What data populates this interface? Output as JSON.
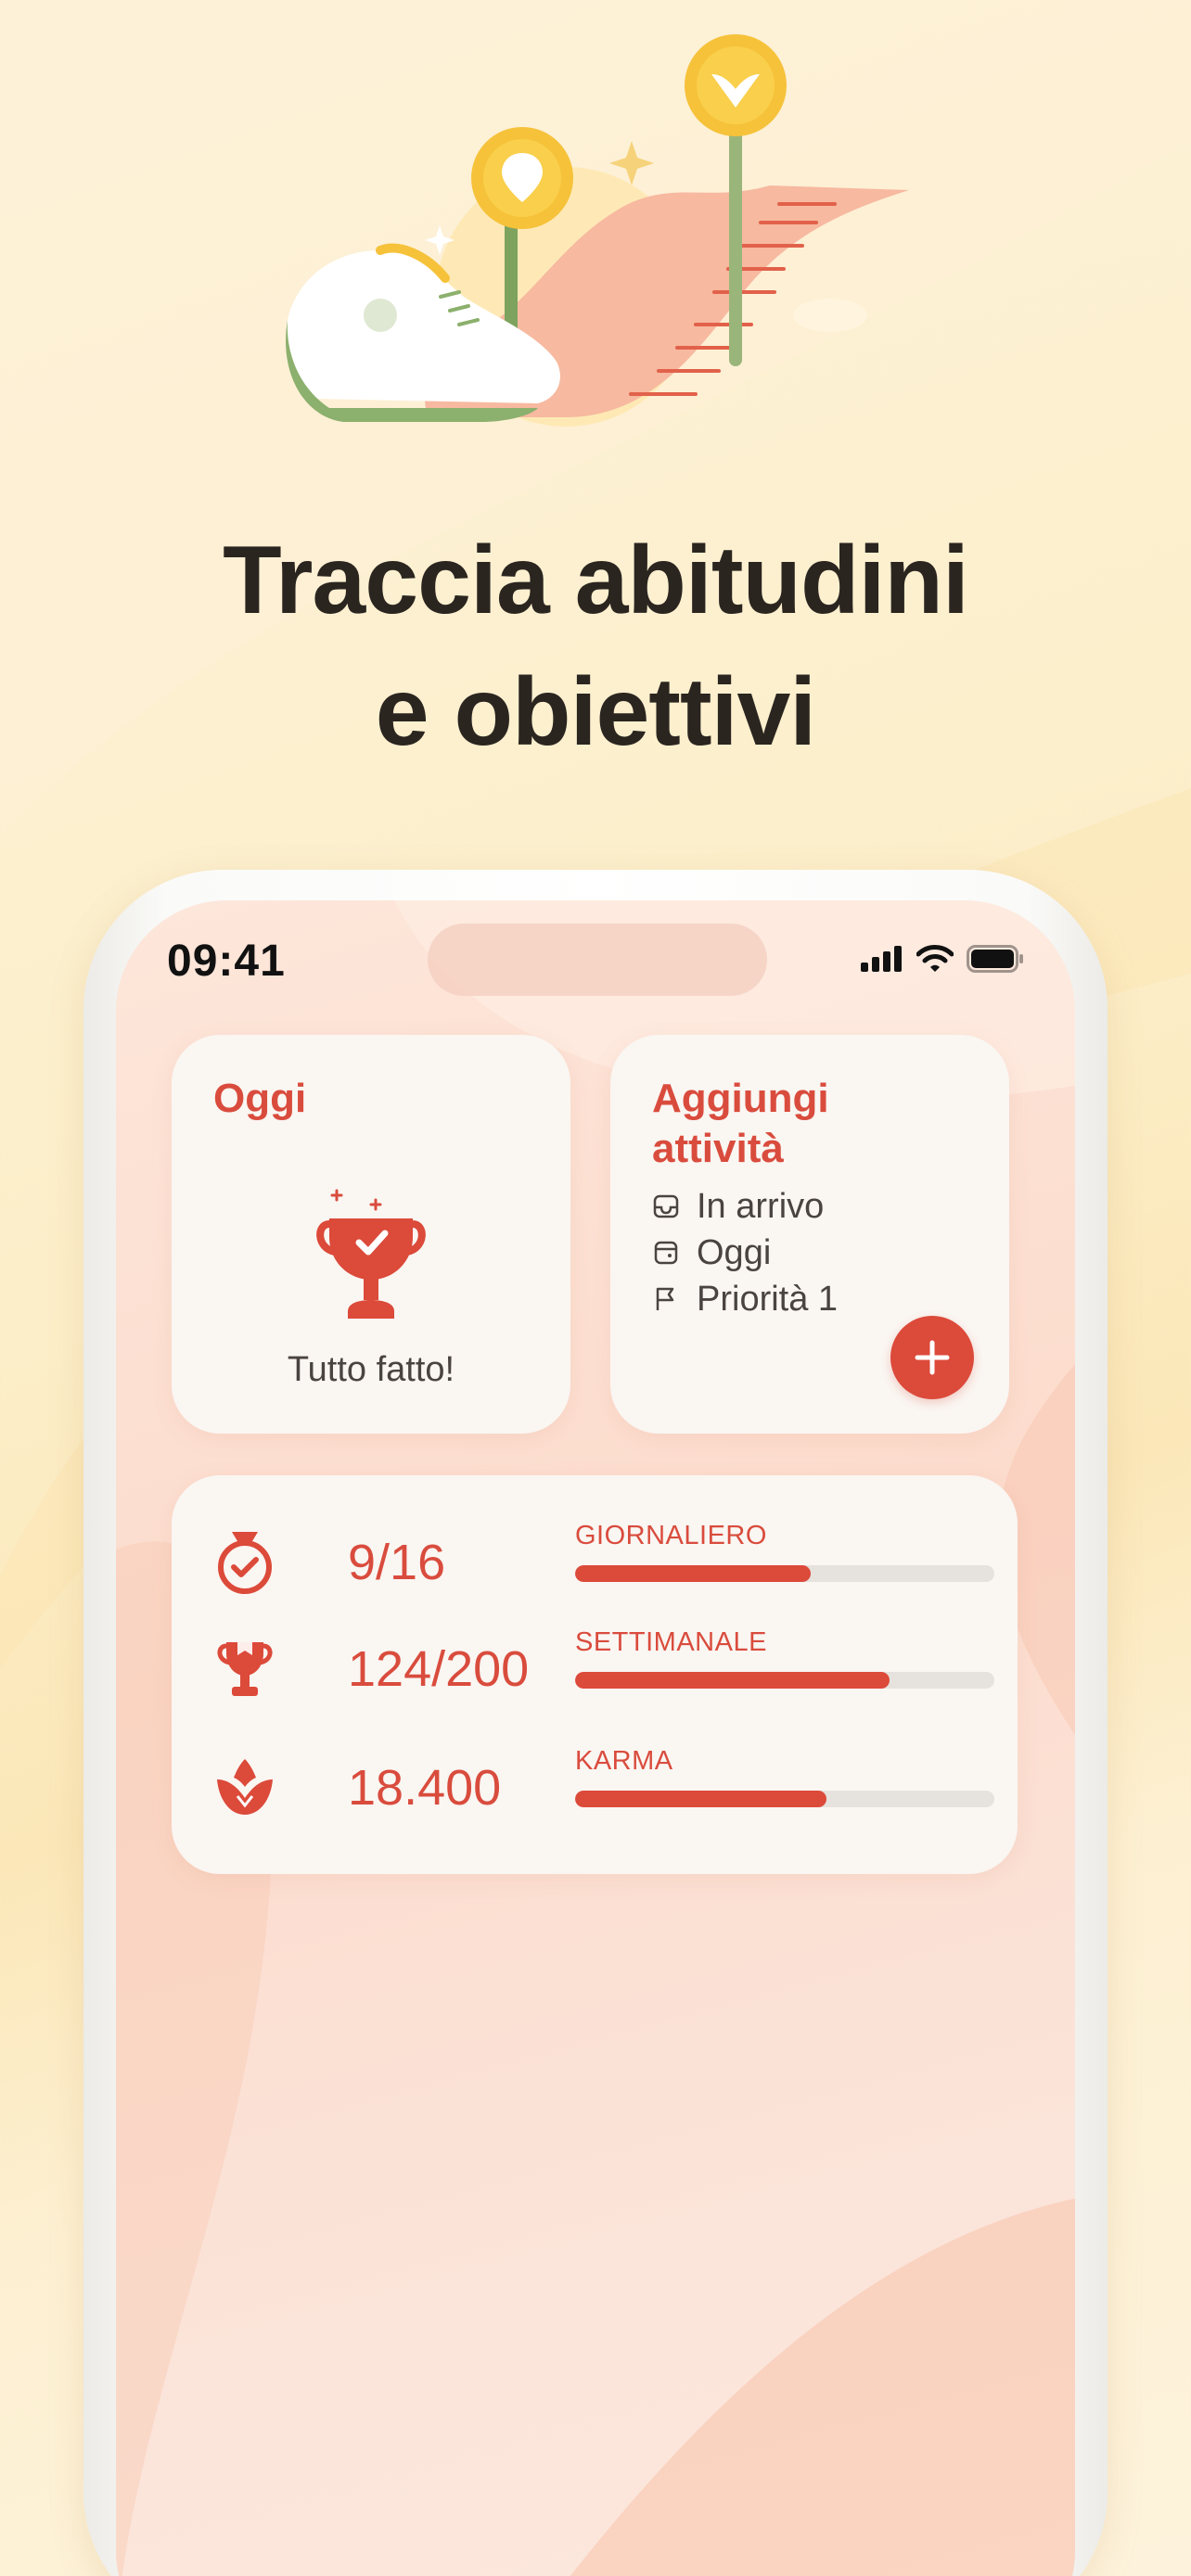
{
  "headline": {
    "line1": "Traccia abitudini",
    "line2": "e obiettivi"
  },
  "status_bar": {
    "time": "09:41",
    "icons": [
      "cellular-signal-icon",
      "wifi-icon",
      "battery-icon"
    ]
  },
  "today_widget": {
    "title": "Oggi",
    "icon": "trophy-check-icon",
    "message": "Tutto fatto!"
  },
  "add_task_widget": {
    "title": "Aggiungi attività",
    "items": [
      {
        "icon": "inbox-icon",
        "label": "In arrivo"
      },
      {
        "icon": "calendar-icon",
        "label": "Oggi"
      },
      {
        "icon": "flag-icon",
        "label": "Priorità 1"
      }
    ],
    "fab_icon": "plus-icon"
  },
  "stats_widget": {
    "rows": [
      {
        "icon": "medal-icon",
        "value": "9/16",
        "label": "GIORNALIERO",
        "progress": 0.5625
      },
      {
        "icon": "trophy-icon",
        "value": "124/200",
        "label": "SETTIMANALE",
        "progress": 0.75
      },
      {
        "icon": "karma-icon",
        "value": "18.400",
        "label": "KARMA",
        "progress": 0.6
      }
    ]
  },
  "colors": {
    "accent": "#dc4a3a",
    "background": "#fdf3dc",
    "screen": "#fde6da",
    "card": "#faf6f2"
  }
}
